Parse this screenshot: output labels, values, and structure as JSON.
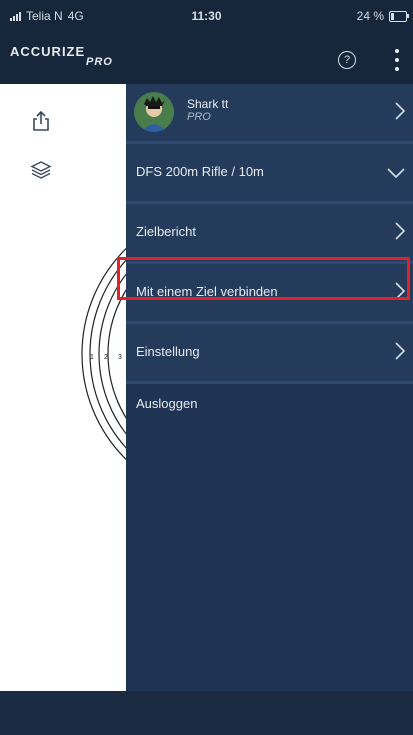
{
  "status_bar": {
    "carrier": "Telia N",
    "network": "4G",
    "time": "11:30",
    "battery": "24 %",
    "battery_level": 0.24
  },
  "header": {
    "logo_top": "ACCURIZE",
    "logo_bottom": "PRO",
    "help_icon": "?"
  },
  "target_numbers": [
    "1",
    "2",
    "3"
  ],
  "drawer": {
    "profile": {
      "name": "Shark tt",
      "tier": "PRO"
    },
    "discipline": "DFS 200m Rifle / 10m",
    "items": [
      {
        "label": "Zielbericht"
      },
      {
        "label": "Mit einem Ziel verbinden"
      },
      {
        "label": "Einstellung"
      }
    ],
    "logout": "Ausloggen"
  },
  "colors": {
    "highlight": "#e0232a",
    "drawer_bg": "#1f3453",
    "header_bg": "#16263b"
  }
}
